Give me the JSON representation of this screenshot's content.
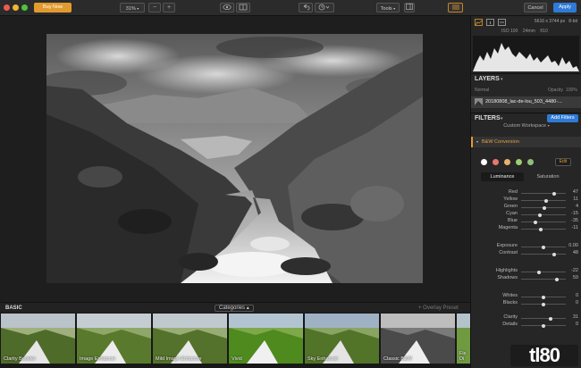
{
  "toolbar": {
    "buy_label": "Buy Now",
    "zoom": "31%",
    "zoom_out": "−",
    "zoom_in": "+",
    "tools_label": "Tools",
    "cancel_label": "Cancel",
    "apply_label": "Apply"
  },
  "photo": {
    "filename": "20180808_lac-de-lou_503_4480-...",
    "dimensions": "5616 x 3744 px",
    "bit_depth": "8-bit",
    "exif": [
      "ISO 100",
      "24mm",
      "f/10"
    ]
  },
  "layers": {
    "title": "LAYERS",
    "blend_mode": "Normal",
    "opacity_label": "Opacity",
    "opacity_value": "100%"
  },
  "filters": {
    "title": "FILTERS",
    "add_label": "Add Filters",
    "workspace": "Custom Workspace",
    "filter_name": "B&W Conversion",
    "edit_label": "Edit",
    "tabs": [
      "Luminance",
      "Saturation"
    ],
    "swatches": [
      "#ffffff",
      "#e8766e",
      "#e6b36a",
      "#9ccf6e",
      "#8fc07a"
    ],
    "sliders": [
      {
        "name": "Red",
        "value": "47",
        "level": 0.73
      },
      {
        "name": "Yellow",
        "value": "11",
        "level": 0.555
      },
      {
        "name": "Green",
        "value": "4",
        "level": 0.52
      },
      {
        "name": "Cyan",
        "value": "-15",
        "level": 0.425
      },
      {
        "name": "Blue",
        "value": "-35",
        "level": 0.325
      },
      {
        "name": "Magenta",
        "value": "-11",
        "level": 0.445
      },
      {
        "name": "Exposure",
        "value": "0.00",
        "level": 0.5
      },
      {
        "name": "Contrast",
        "value": "48",
        "level": 0.74
      },
      {
        "name": "Highlights",
        "value": "-22",
        "level": 0.39
      },
      {
        "name": "Shadows",
        "value": "59",
        "level": 0.795
      },
      {
        "name": "Whites",
        "value": "0",
        "level": 0.5
      },
      {
        "name": "Blacks",
        "value": "0",
        "level": 0.5
      },
      {
        "name": "Clarity",
        "value": "31",
        "level": 0.655
      },
      {
        "name": "Details",
        "value": "0",
        "level": 0.5
      }
    ]
  },
  "presets": {
    "category": "BASIC",
    "categories_label": "Categories",
    "overlay_label": "+ Overlay Preset",
    "items": [
      "Clarity Booster",
      "Image Enhancer",
      "Mild Image Enhancer",
      "Vivid",
      "Sky Enhancer",
      "Classic B&W",
      "Fix Di"
    ]
  },
  "watermark": "tl80"
}
